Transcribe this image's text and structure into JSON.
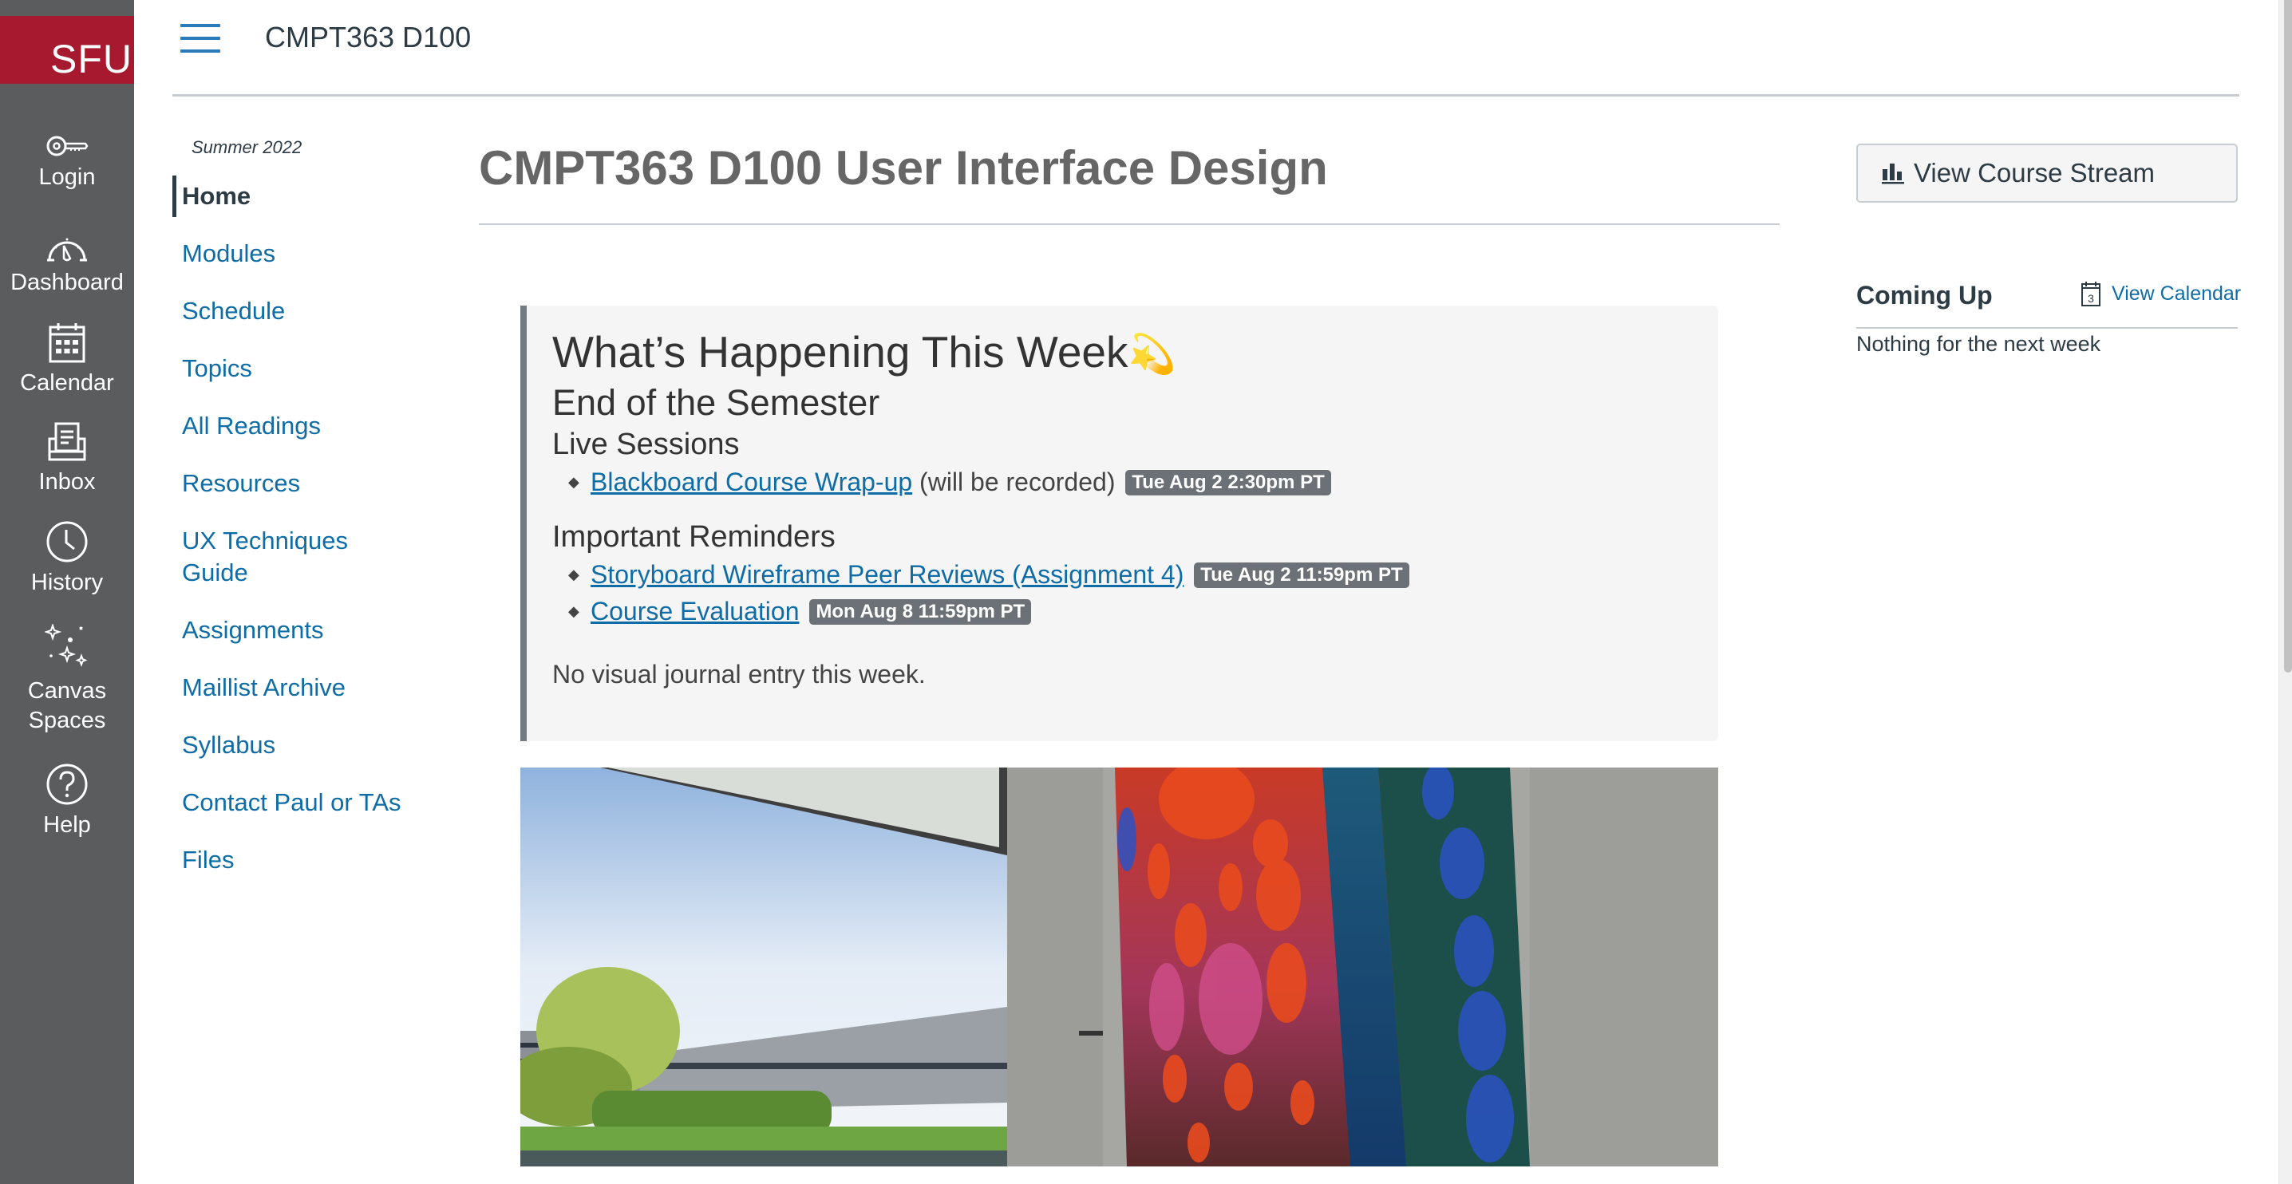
{
  "global_nav": {
    "logo_text": "SFU",
    "brand_color": "#a6192e",
    "items": [
      {
        "label": "Login",
        "icon": "key-icon"
      },
      {
        "label": "Dashboard",
        "icon": "dashboard-icon"
      },
      {
        "label": "Calendar",
        "icon": "calendar-icon"
      },
      {
        "label": "Inbox",
        "icon": "inbox-icon"
      },
      {
        "label": "History",
        "icon": "clock-icon"
      },
      {
        "label": "Canvas Spaces",
        "icon": "sparkles-icon"
      },
      {
        "label": "Help",
        "icon": "help-icon"
      }
    ]
  },
  "header": {
    "course_code": "CMPT363 D100"
  },
  "course_nav": {
    "term": "Summer 2022",
    "items": [
      {
        "label": "Home",
        "active": true
      },
      {
        "label": "Modules"
      },
      {
        "label": "Schedule"
      },
      {
        "label": "Topics"
      },
      {
        "label": "All Readings"
      },
      {
        "label": "Resources"
      },
      {
        "label": "UX Techniques Guide"
      },
      {
        "label": "Assignments"
      },
      {
        "label": "Maillist Archive"
      },
      {
        "label": "Syllabus"
      },
      {
        "label": "Contact Paul or TAs"
      },
      {
        "label": "Files"
      }
    ]
  },
  "main": {
    "title": "CMPT363 D100 User Interface Design",
    "week_box": {
      "heading": "What’s Happening This Week",
      "heading_emoji": "💫",
      "subheading": "End of the Semester",
      "live_sessions": {
        "heading": "Live Sessions",
        "items": [
          {
            "link": "Blackboard Course Wrap-up",
            "note": "(will be recorded)",
            "badge": "Tue Aug 2 2:30pm PT"
          }
        ]
      },
      "reminders": {
        "heading": "Important Reminders",
        "items": [
          {
            "link": "Storyboard Wireframe Peer Reviews (Assignment 4)",
            "badge": "Tue Aug 2 11:59pm PT"
          },
          {
            "link": "Course Evaluation",
            "badge": "Mon Aug 8 11:59pm PT"
          }
        ]
      },
      "journal_note": "No visual journal entry this week."
    },
    "hero_image_alt": "Campus courtyard with colorful mosaic mural on concrete pillar"
  },
  "aside": {
    "stream_button": "View Course Stream",
    "coming_up_title": "Coming Up",
    "view_calendar": "View Calendar",
    "calendar_icon_day": "3",
    "empty_message": "Nothing for the next week"
  },
  "colors": {
    "link": "#0e6ca7",
    "nav_bg": "#5b5c5e",
    "badge_bg": "#6b7176"
  }
}
